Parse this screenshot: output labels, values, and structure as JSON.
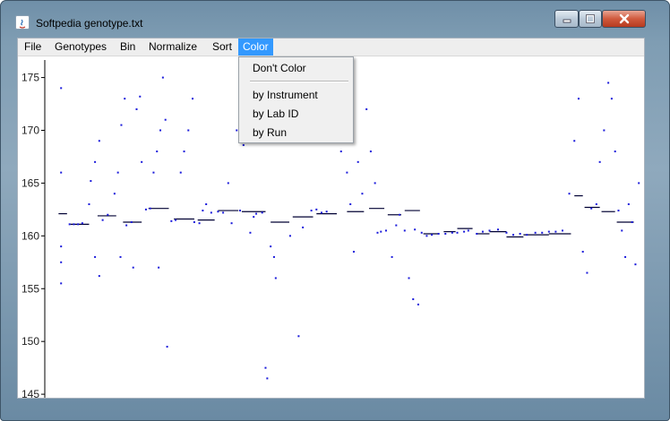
{
  "window": {
    "title": "Softpedia genotype.txt"
  },
  "menubar": {
    "items": [
      {
        "label": "File"
      },
      {
        "label": "Genotypes"
      },
      {
        "label": "Bin"
      },
      {
        "label": "Normalize"
      },
      {
        "label": "Sort"
      },
      {
        "label": "Color"
      }
    ],
    "active": "Color"
  },
  "color_menu": {
    "items": [
      {
        "label": "Don't Color"
      },
      {
        "label": "by Instrument"
      },
      {
        "label": "by Lab ID"
      },
      {
        "label": "by Run"
      }
    ]
  },
  "colors": {
    "point": "#1a1adb",
    "line": "#000033",
    "accent": "#3399ff"
  },
  "chart_data": {
    "type": "scatter",
    "title": "",
    "xlabel": "",
    "ylabel": "",
    "ylim": [
      144.5,
      177
    ],
    "yticks": [
      175,
      170,
      165,
      160,
      155,
      150,
      145
    ],
    "clipped_tick_label": "145",
    "grid": false,
    "series_points": [
      [
        15,
        174
      ],
      [
        15,
        166
      ],
      [
        15,
        159
      ],
      [
        15,
        157.5
      ],
      [
        15,
        155.5
      ],
      [
        25,
        161.1
      ],
      [
        30,
        161.1
      ],
      [
        35,
        161.1
      ],
      [
        40,
        161.2
      ],
      [
        48,
        163
      ],
      [
        50,
        165.2
      ],
      [
        55,
        167
      ],
      [
        60,
        169
      ],
      [
        55,
        158
      ],
      [
        60,
        156.2
      ],
      [
        64,
        161.5
      ],
      [
        70,
        162
      ],
      [
        78,
        164
      ],
      [
        82,
        166
      ],
      [
        86,
        170.5
      ],
      [
        90,
        173
      ],
      [
        85,
        158
      ],
      [
        92,
        161
      ],
      [
        98,
        161.3
      ],
      [
        100,
        157
      ],
      [
        104,
        172
      ],
      [
        108,
        173.2
      ],
      [
        110,
        167
      ],
      [
        115,
        162.5
      ],
      [
        120,
        162.6
      ],
      [
        124,
        166
      ],
      [
        128,
        168
      ],
      [
        132,
        170
      ],
      [
        135,
        175
      ],
      [
        138,
        171
      ],
      [
        130,
        157
      ],
      [
        140,
        149.5
      ],
      [
        145,
        161.4
      ],
      [
        150,
        161.5
      ],
      [
        156,
        166
      ],
      [
        160,
        168
      ],
      [
        165,
        170
      ],
      [
        170,
        173
      ],
      [
        172,
        161.3
      ],
      [
        178,
        161.2
      ],
      [
        182,
        162.4
      ],
      [
        186,
        163
      ],
      [
        192,
        162.2
      ],
      [
        200,
        162.3
      ],
      [
        206,
        162.2
      ],
      [
        212,
        165
      ],
      [
        216,
        161.2
      ],
      [
        222,
        170
      ],
      [
        226,
        162.4
      ],
      [
        230,
        168.6
      ],
      [
        236,
        173.3
      ],
      [
        238,
        160.3
      ],
      [
        242,
        161.8
      ],
      [
        245,
        162.1
      ],
      [
        252,
        162.2
      ],
      [
        256,
        147.5
      ],
      [
        258,
        146.5
      ],
      [
        262,
        159
      ],
      [
        266,
        158
      ],
      [
        268,
        156
      ],
      [
        275,
        169
      ],
      [
        280,
        171
      ],
      [
        285,
        160
      ],
      [
        290,
        174.5
      ],
      [
        295,
        150.5
      ],
      [
        300,
        160.8
      ],
      [
        310,
        162.4
      ],
      [
        316,
        162.5
      ],
      [
        322,
        162.2
      ],
      [
        328,
        162.3
      ],
      [
        335,
        172.5
      ],
      [
        340,
        170.5
      ],
      [
        345,
        168
      ],
      [
        352,
        166
      ],
      [
        356,
        163
      ],
      [
        360,
        158.5
      ],
      [
        365,
        167
      ],
      [
        370,
        164
      ],
      [
        375,
        172
      ],
      [
        380,
        168
      ],
      [
        385,
        165
      ],
      [
        388,
        160.3
      ],
      [
        392,
        160.4
      ],
      [
        398,
        160.5
      ],
      [
        405,
        158
      ],
      [
        410,
        161
      ],
      [
        414,
        162
      ],
      [
        420,
        160.5
      ],
      [
        425,
        156
      ],
      [
        430,
        154
      ],
      [
        432,
        160.6
      ],
      [
        436,
        153.5
      ],
      [
        440,
        160.3
      ],
      [
        446,
        160.0
      ],
      [
        452,
        160.1
      ],
      [
        460,
        160.2
      ],
      [
        468,
        160.2
      ],
      [
        476,
        160.3
      ],
      [
        482,
        160.3
      ],
      [
        490,
        160.4
      ],
      [
        495,
        160.5
      ],
      [
        505,
        160.2
      ],
      [
        512,
        160.4
      ],
      [
        520,
        160.5
      ],
      [
        530,
        160.6
      ],
      [
        540,
        160.3
      ],
      [
        548,
        160.1
      ],
      [
        556,
        160.2
      ],
      [
        564,
        160.1
      ],
      [
        574,
        160.3
      ],
      [
        582,
        160.3
      ],
      [
        590,
        160.4
      ],
      [
        598,
        160.4
      ],
      [
        606,
        160.5
      ],
      [
        614,
        164
      ],
      [
        620,
        169
      ],
      [
        625,
        173
      ],
      [
        630,
        158.5
      ],
      [
        635,
        156.5
      ],
      [
        640,
        162.6
      ],
      [
        646,
        163
      ],
      [
        650,
        167
      ],
      [
        655,
        170
      ],
      [
        660,
        174.5
      ],
      [
        664,
        173
      ],
      [
        668,
        168
      ],
      [
        672,
        162.4
      ],
      [
        676,
        160.5
      ],
      [
        680,
        158
      ],
      [
        684,
        163
      ],
      [
        688,
        161.3
      ],
      [
        692,
        157.3
      ],
      [
        696,
        165
      ]
    ],
    "series_segments": [
      [
        12,
        22,
        162.1
      ],
      [
        26,
        48,
        161.1
      ],
      [
        58,
        80,
        161.9
      ],
      [
        88,
        110,
        161.3
      ],
      [
        118,
        142,
        162.6
      ],
      [
        148,
        172,
        161.6
      ],
      [
        176,
        196,
        161.5
      ],
      [
        200,
        224,
        162.4
      ],
      [
        228,
        256,
        162.3
      ],
      [
        262,
        284,
        161.3
      ],
      [
        288,
        312,
        161.8
      ],
      [
        316,
        340,
        162.1
      ],
      [
        352,
        372,
        162.3
      ],
      [
        378,
        396,
        162.6
      ],
      [
        400,
        416,
        162.0
      ],
      [
        420,
        438,
        162.4
      ],
      [
        442,
        460,
        160.2
      ],
      [
        466,
        480,
        160.4
      ],
      [
        482,
        500,
        160.7
      ],
      [
        504,
        520,
        160.2
      ],
      [
        520,
        540,
        160.4
      ],
      [
        540,
        560,
        159.9
      ],
      [
        560,
        590,
        160.1
      ],
      [
        590,
        616,
        160.2
      ],
      [
        620,
        630,
        163.8
      ],
      [
        632,
        650,
        162.7
      ],
      [
        652,
        668,
        162.3
      ],
      [
        670,
        690,
        161.3
      ]
    ]
  }
}
